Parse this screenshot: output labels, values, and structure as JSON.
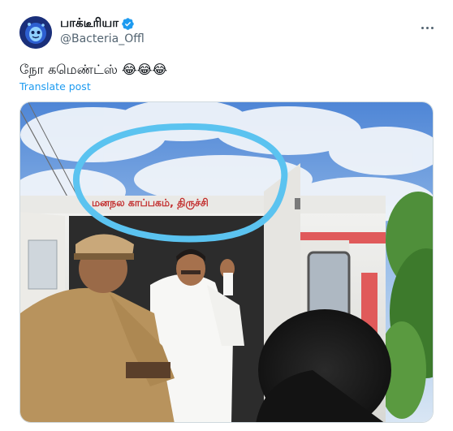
{
  "post": {
    "display_name": "பாக்டீரியா",
    "handle": "@Bacteria_Offl",
    "text": "நோ கமெண்ட்ஸ் 😂😂😂",
    "translate_label": "Translate post",
    "more_label": "More"
  },
  "media": {
    "vehicle_sign_text": "மனநல காப்பகம், திருச்சி",
    "alt": "Photo of a man in white shirt being put into an ambulance van beside a police officer, with a blue circle drawn around the van sign"
  },
  "icons": {
    "verified": "verified-badge-icon",
    "more": "more-options-icon"
  },
  "colors": {
    "accent": "#1d9bf0",
    "secondary_text": "#536471",
    "annotation_circle": "#5bc3f0"
  }
}
